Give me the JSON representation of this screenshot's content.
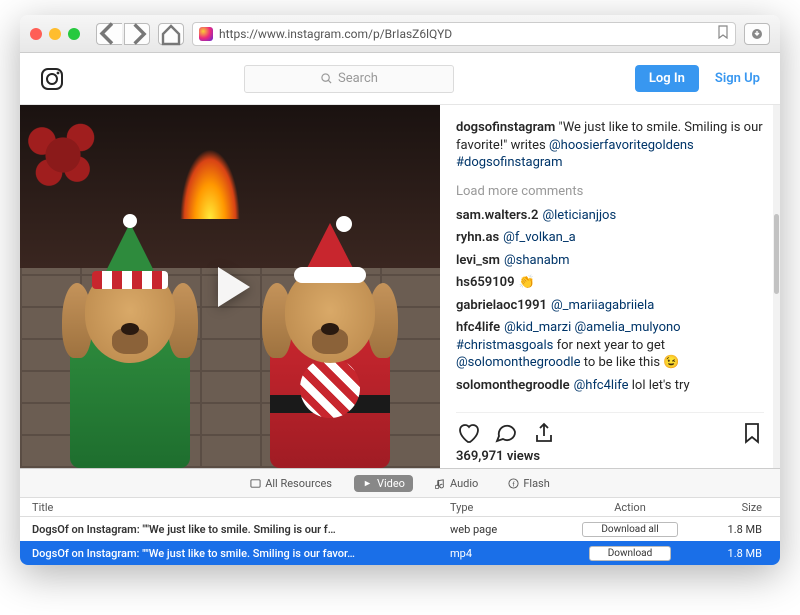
{
  "browser": {
    "url": "https://www.instagram.com/p/BrIasZ6lQYD"
  },
  "instagram": {
    "search_placeholder": "Search",
    "login": "Log In",
    "signup": "Sign Up"
  },
  "post": {
    "author": "dogsofinstagram",
    "caption_text": "\"We just like to smile. Smiling is our favorite!\" writes ",
    "caption_mention": "@hoosierfavoritegoldens",
    "caption_hashtag": "#dogsofinstagram",
    "load_more": "Load more comments",
    "views": "369,971 views"
  },
  "comments": [
    {
      "user": "sam.walters.2",
      "body": "@leticianjjos"
    },
    {
      "user": "ryhn.as",
      "body": "@f_volkan_a"
    },
    {
      "user": "levi_sm",
      "body": "@shanabm"
    },
    {
      "user": "hs659109",
      "body": "👏"
    },
    {
      "user": "gabrielaoc1991",
      "body": "@_mariiagabriiela"
    },
    {
      "user": "hfc4life",
      "body": "@kid_marzi @amelia_mulyono #christmasgoals for next year to get @solomonthegroodle to be like this 😉"
    },
    {
      "user": "solomonthegroodle",
      "body": "@hfc4life lol let's try"
    }
  ],
  "inspector": {
    "tabs": {
      "all": "All Resources",
      "video": "Video",
      "audio": "Audio",
      "flash": "Flash"
    },
    "columns": {
      "title": "Title",
      "type": "Type",
      "action": "Action",
      "size": "Size"
    },
    "rows": [
      {
        "title": "DogsOf on Instagram: \"\"We just like to smile. Smiling is our f…",
        "type": "web page",
        "action": "Download all",
        "size": "1.8 MB"
      },
      {
        "title": "DogsOf on Instagram: \"\"We just like to smile. Smiling is our favor…",
        "type": "mp4",
        "action": "Download",
        "size": "1.8 MB"
      }
    ]
  }
}
